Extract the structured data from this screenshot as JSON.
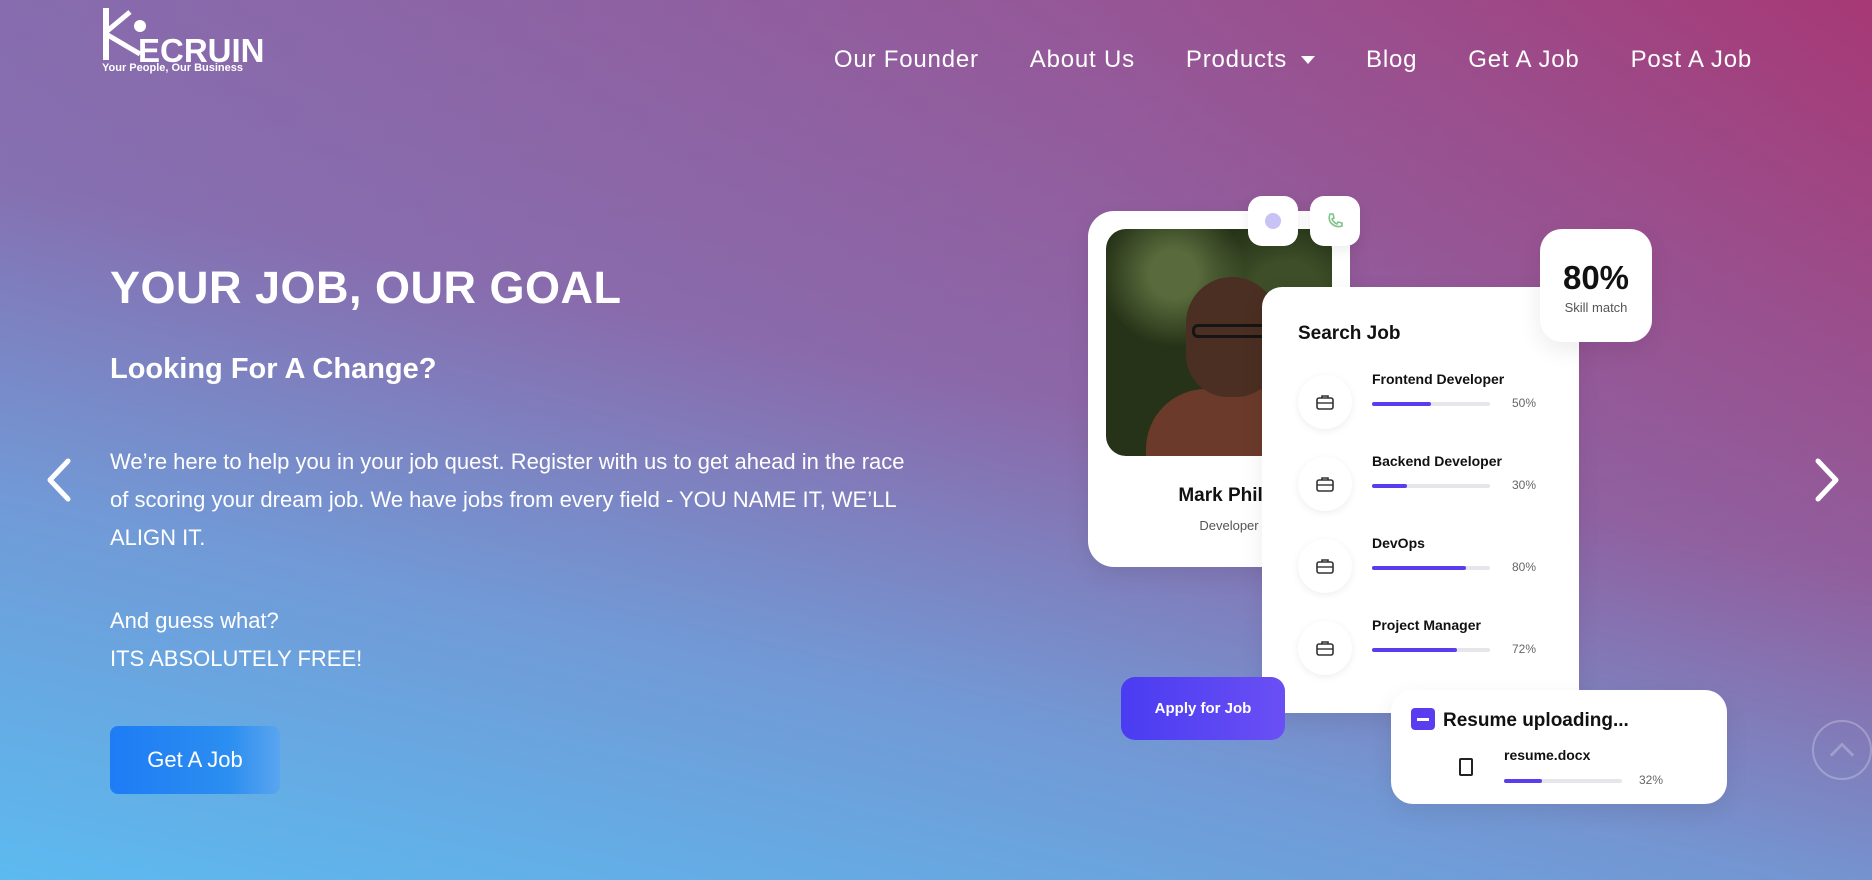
{
  "logo": {
    "text": "ECRUIN",
    "tagline": "Your People, Our Business"
  },
  "nav": {
    "items": [
      {
        "label": "Our Founder"
      },
      {
        "label": "About Us"
      },
      {
        "label": "Products"
      },
      {
        "label": "Blog"
      },
      {
        "label": "Get A Job"
      },
      {
        "label": "Post A Job"
      }
    ]
  },
  "hero": {
    "title": "YOUR JOB, OUR GOAL",
    "subtitle": "Looking For A Change?",
    "paragraph": "We’re here to help you in your job quest. Register with us to get ahead in the race of scoring your dream job. We have jobs from every field - YOU NAME IT, WE’LL ALIGN IT.",
    "line1": "And guess what?",
    "line2": "ITS ABSOLUTELY FREE!",
    "cta": "Get A Job"
  },
  "mockup": {
    "profile": {
      "name": "Mark Philip",
      "role": "Developer"
    },
    "match": {
      "value": "80%",
      "label": "Skill match"
    },
    "search": {
      "title": "Search Job",
      "jobs": [
        {
          "name": "Frontend Developer",
          "percent": "50%",
          "progress": 0.5
        },
        {
          "name": "Backend Developer",
          "percent": "30%",
          "progress": 0.3
        },
        {
          "name": "DevOps",
          "percent": "80%",
          "progress": 0.8
        },
        {
          "name": "Project Manager",
          "percent": "72%",
          "progress": 0.72
        }
      ]
    },
    "apply": "Apply for Job",
    "resume": {
      "title": "Resume uploading...",
      "file": "resume.docx",
      "percent": "32%",
      "progress": 0.32
    }
  },
  "colors": {
    "accent": "#5b3df0",
    "cta": "#1e7cf5"
  }
}
